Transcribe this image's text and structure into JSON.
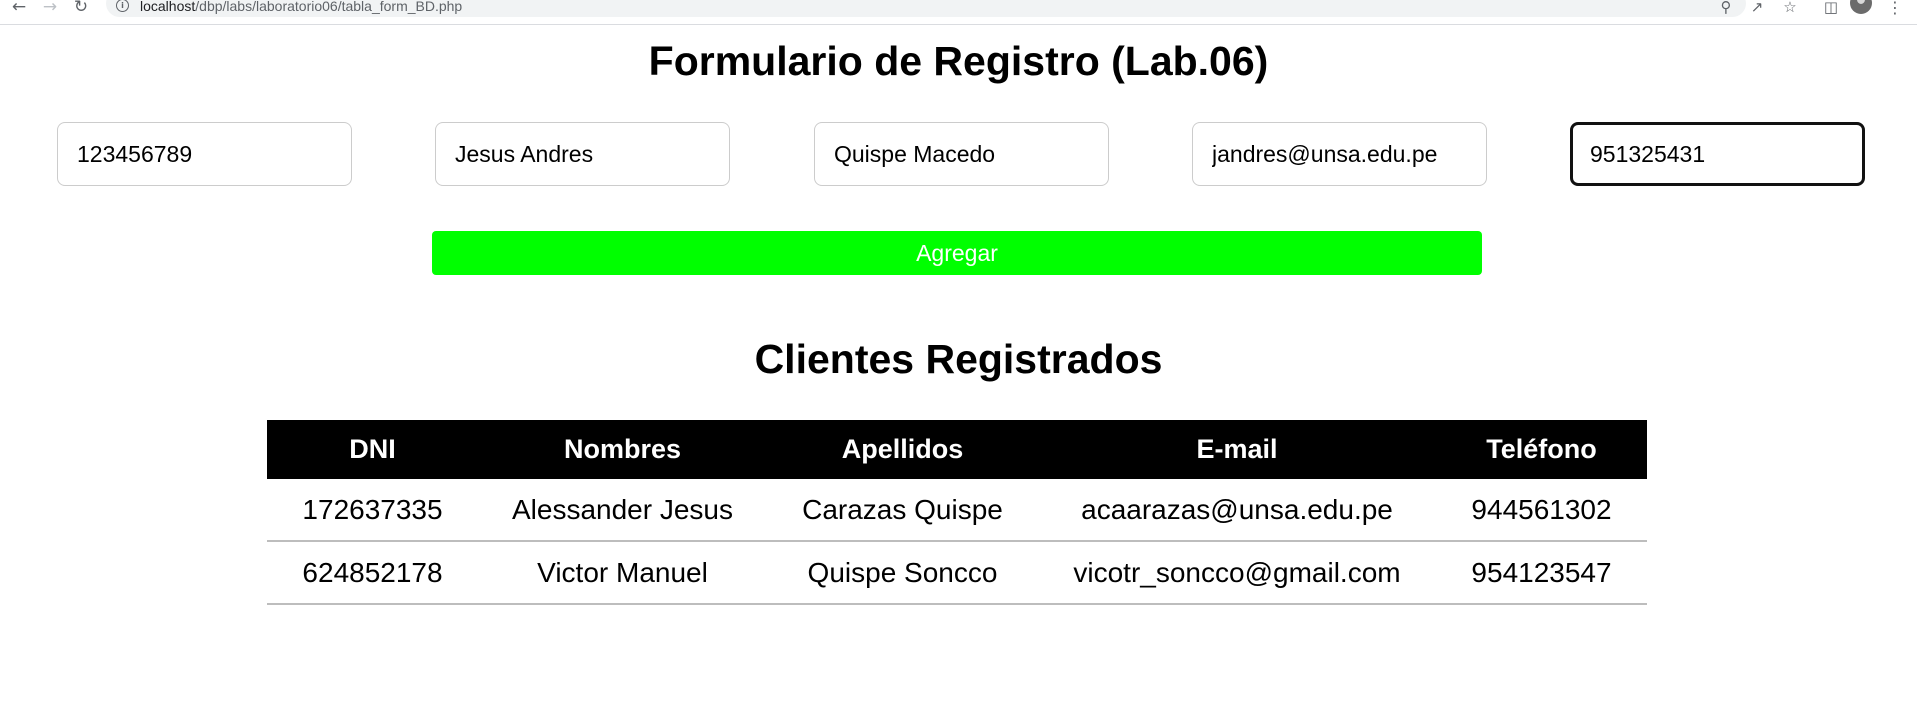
{
  "browser": {
    "url_host": "localhost",
    "url_path": "/dbp/labs/laboratorio06/tabla_form_BD.php",
    "icons": {
      "back": "arrow-left-icon",
      "forward": "arrow-right-icon",
      "reload": "reload-icon",
      "info": "info-icon",
      "zoom": "zoom-icon",
      "share": "share-icon",
      "bookmark": "star-icon",
      "side_panel": "side-panel-icon",
      "profile": "avatar",
      "menu": "kebab-menu-icon"
    }
  },
  "form": {
    "title": "Formulario de Registro (Lab.06)",
    "fields": [
      {
        "value": "123456789"
      },
      {
        "value": "Jesus Andres"
      },
      {
        "value": "Quispe Macedo"
      },
      {
        "value": "jandres@unsa.edu.pe"
      },
      {
        "value": "951325431",
        "focused": true
      }
    ],
    "submit_label": "Agregar",
    "submit_color": "#00ff00"
  },
  "clients": {
    "title": "Clientes Registrados",
    "columns": [
      "DNI",
      "Nombres",
      "Apellidos",
      "E-mail",
      "Teléfono"
    ],
    "rows": [
      [
        "172637335",
        "Alessander Jesus",
        "Carazas Quispe",
        "acaarazas@unsa.edu.pe",
        "944561302"
      ],
      [
        "624852178",
        "Victor Manuel",
        "Quispe Soncco",
        "vicotr_soncco@gmail.com",
        "954123547"
      ]
    ],
    "header_bg": "#000000"
  }
}
